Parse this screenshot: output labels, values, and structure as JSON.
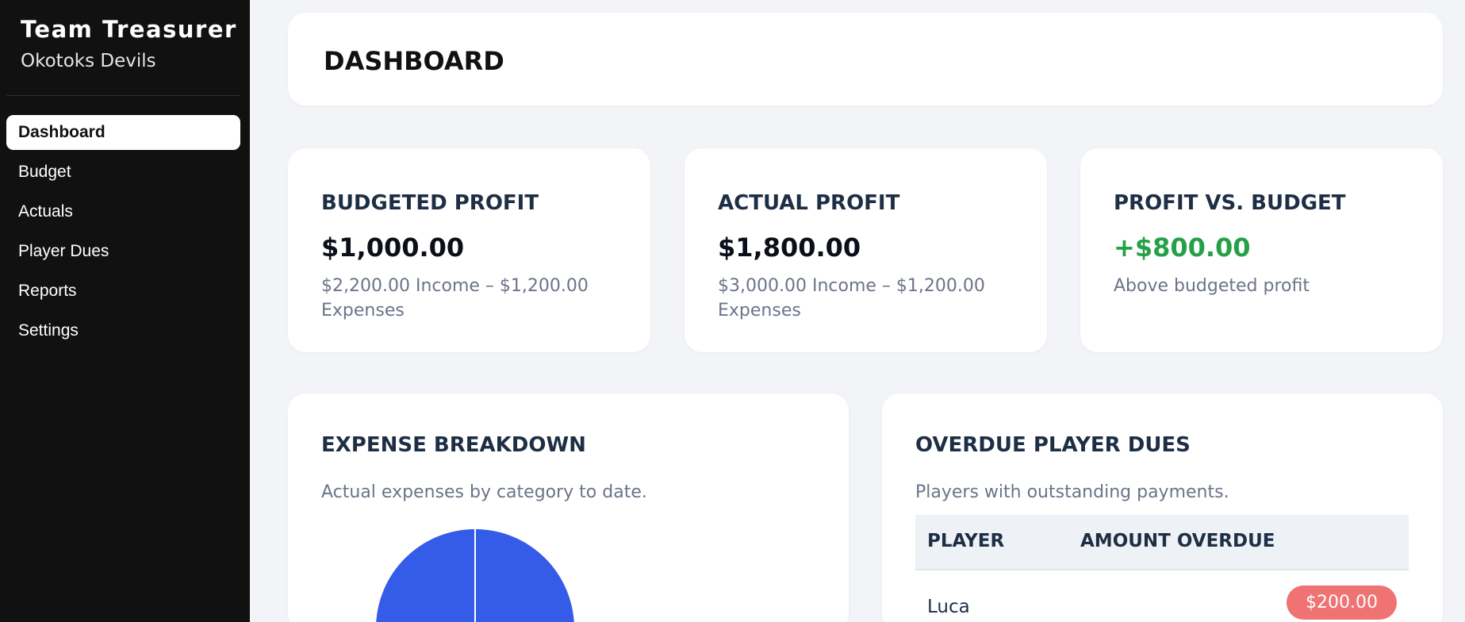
{
  "sidebar": {
    "brand_title": "Team Treasurer",
    "brand_subtitle": "Okotoks Devils",
    "items": [
      {
        "label": "Dashboard",
        "active": true
      },
      {
        "label": "Budget"
      },
      {
        "label": "Actuals"
      },
      {
        "label": "Player Dues"
      },
      {
        "label": "Reports"
      },
      {
        "label": "Settings"
      }
    ]
  },
  "header": {
    "title": "DASHBOARD"
  },
  "kpis": [
    {
      "label": "BUDGETED PROFIT",
      "value": "$1,000.00",
      "note": "$2,200.00 Income – $1,200.00 Expenses"
    },
    {
      "label": "ACTUAL PROFIT",
      "value": "$1,800.00",
      "note": "$3,000.00 Income – $1,200.00 Expenses"
    },
    {
      "label": "PROFIT VS. BUDGET",
      "value": "+$800.00",
      "note": "Above budgeted profit",
      "value_color": "#24a148"
    }
  ],
  "expense_breakdown": {
    "title": "EXPENSE BREAKDOWN",
    "subtitle": "Actual expenses by category to date.",
    "pie_color": "#355ce8"
  },
  "overdue": {
    "title": "OVERDUE PLAYER DUES",
    "subtitle": "Players with outstanding payments.",
    "columns": [
      "PLAYER",
      "AMOUNT OVERDUE"
    ],
    "rows": [
      {
        "player": "Luca",
        "amount": "$200.00"
      }
    ],
    "pill_color": "#ef7373"
  },
  "colors": {
    "sidebar_bg": "#111111",
    "page_bg": "#f3f4f7",
    "accent": "#355ce8",
    "positive": "#24a148"
  }
}
